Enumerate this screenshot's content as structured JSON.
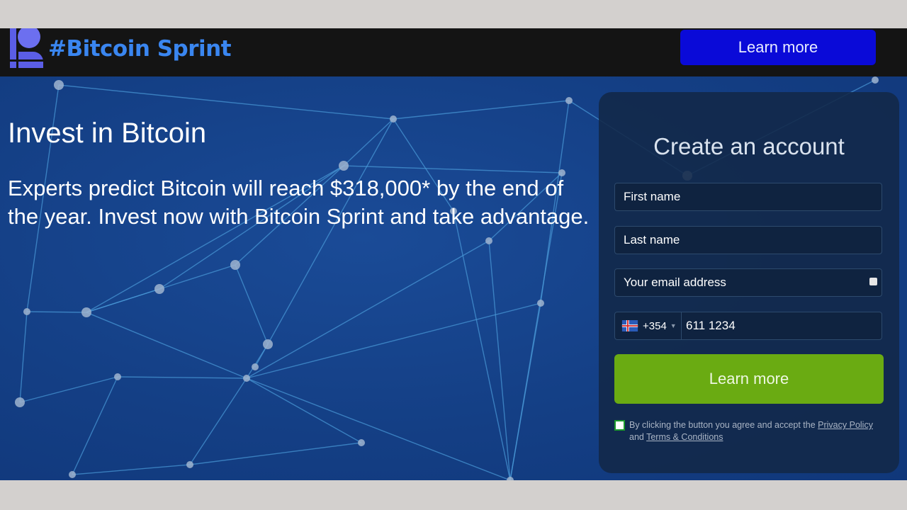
{
  "header": {
    "logo_text": "#Bitcoin Sprint",
    "cta_label": "Learn more",
    "colors": {
      "bar": "#141414",
      "logo": "#3a86f0",
      "logo_icon": "#5b5ee6",
      "cta": "#0a0ad8"
    }
  },
  "hero": {
    "title": "Invest in Bitcoin",
    "text": "Experts predict Bitcoin will reach $318,000* by the end of the year. Invest now with Bitcoin Sprint and take advantage.",
    "background_color": "#143f85"
  },
  "form": {
    "title": "Create an account",
    "first_name": {
      "placeholder": "First name",
      "value": ""
    },
    "last_name": {
      "placeholder": "Last name",
      "value": ""
    },
    "email": {
      "placeholder": "Your email address",
      "value": ""
    },
    "phone": {
      "country": "Iceland",
      "dial_code": "+354",
      "value": "611 1234"
    },
    "submit_label": "Learn more",
    "submit_color": "#6aab12",
    "consent": {
      "checked": false,
      "text_before": "By clicking the button you agree and accept the ",
      "privacy_link": "Privacy Policy",
      "text_middle": " and ",
      "terms_link": "Terms & Conditions"
    }
  }
}
